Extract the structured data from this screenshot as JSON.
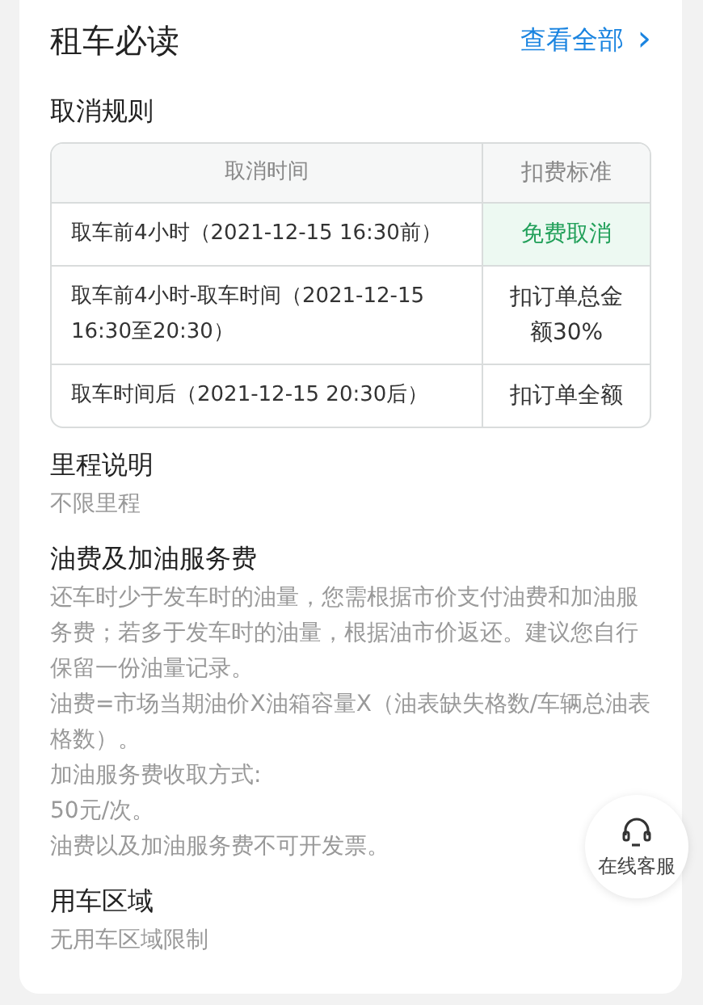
{
  "header": {
    "title": "租车必读",
    "link": "查看全部",
    "link_arrow": "›"
  },
  "cancel": {
    "heading": "取消规则",
    "columns": [
      "取消时间",
      "扣费标准"
    ],
    "rows": [
      {
        "time": "取车前4小时（2021-12-15 16:30前）",
        "fee": "免费取消",
        "highlight": true
      },
      {
        "time": "取车前4小时-取车时间（2021-12-15 16:30至20:30）",
        "fee": "扣订单总金额30%",
        "highlight": false
      },
      {
        "time": "取车时间后（2021-12-15 20:30后）",
        "fee": "扣订单全额",
        "highlight": false
      }
    ]
  },
  "sections": [
    {
      "heading": "里程说明",
      "lines": [
        "不限里程"
      ]
    },
    {
      "heading": "油费及加油服务费",
      "lines": [
        "还车时少于发车时的油量，您需根据市价支付油费和加油服务费；若多于发车时的油量，根据油市价返还。建议您自行保留一份油量记录。",
        "油费=市场当期油价X油箱容量X（油表缺失格数/车辆总油表格数）。",
        "加油服务费收取方式:",
        "50元/次。",
        "油费以及加油服务费不可开发票。"
      ]
    },
    {
      "heading": "用车区域",
      "lines": [
        "无用车区域限制"
      ]
    }
  ],
  "service_button": {
    "label": "在线客服"
  }
}
